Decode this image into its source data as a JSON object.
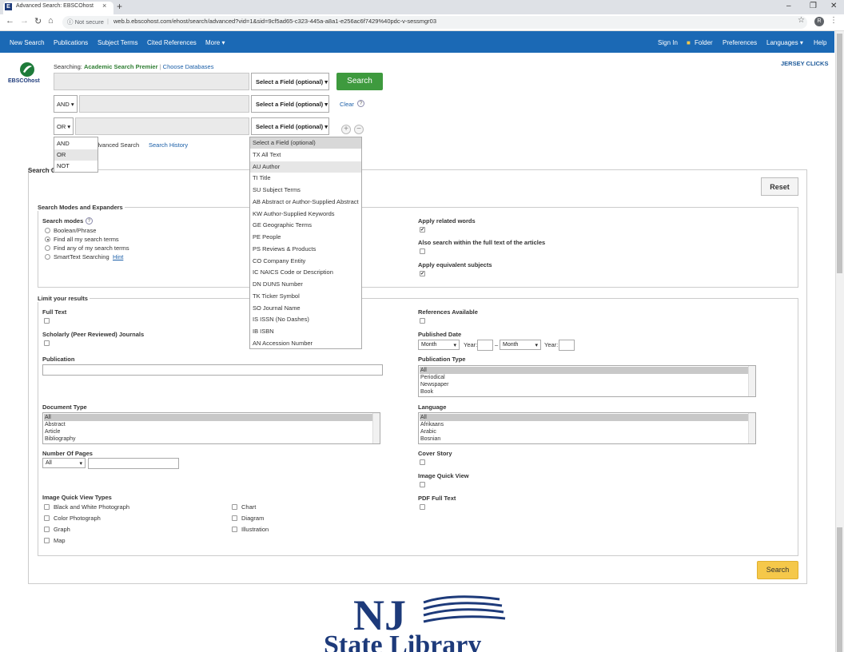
{
  "browser": {
    "tab_title": "Advanced Search: EBSCOhost",
    "tab_favicon": "E",
    "security": "Not secure",
    "url": "web.b.ebscohost.com/ehost/search/advanced?vid=1&sid=9cf5ad65-c323-445a-a8a1-e256ac6f7429%40pdc-v-sessmgr03",
    "profile_initial": "R"
  },
  "toolbar": {
    "left": [
      "New Search",
      "Publications",
      "Subject Terms",
      "Cited References",
      "More ▾"
    ],
    "right": [
      "Sign In",
      "Folder",
      "Preferences",
      "Languages ▾",
      "Help"
    ]
  },
  "logo": {
    "text": "EBSCOhost"
  },
  "institution": "JERSEY CLICKS",
  "searching": {
    "prefix": "Searching:",
    "database": "Academic Search Premier",
    "separator": "|",
    "choose": "Choose Databases"
  },
  "search_rows": [
    {
      "op": "",
      "field": "Select a Field (optional) ▾"
    },
    {
      "op": "AND ▾",
      "field": "Select a Field (optional) ▾"
    },
    {
      "op": "OR ▾",
      "field": "Select a Field (optional) ▾"
    }
  ],
  "search_button": "Search",
  "clear_link": "Clear",
  "help_icon": "?",
  "plus_icon": "+",
  "minus_icon": "−",
  "links": {
    "advanced": "dvanced Search",
    "history": "Search History"
  },
  "op_dropdown": {
    "items": [
      "AND",
      "OR",
      "NOT"
    ],
    "highlighted": 1
  },
  "field_dropdown": {
    "items": [
      "Select a Field (optional)",
      "TX All Text",
      "AU Author",
      "TI Title",
      "SU Subject Terms",
      "AB Abstract or Author-Supplied Abstract",
      "KW Author-Supplied Keywords",
      "GE Geographic Terms",
      "PE People",
      "PS Reviews & Products",
      "CO Company Entity",
      "IC NAICS Code or Description",
      "DN DUNS Number",
      "TK Ticker Symbol",
      "SO Journal Name",
      "IS ISSN (No Dashes)",
      "IB ISBN",
      "AN Accession Number"
    ],
    "highlighted": 2
  },
  "options": {
    "title": "Search O",
    "reset": "Reset",
    "modes_legend": "Search Modes and Expanders",
    "modes_label": "Search modes",
    "modes": [
      "Boolean/Phrase",
      "Find all my search terms",
      "Find any of my search terms",
      "SmartText Searching"
    ],
    "modes_selected": 1,
    "hint": "Hint",
    "expanders": [
      {
        "label": "Apply related words",
        "checked": true
      },
      {
        "label": "Also search within the full text of the articles",
        "checked": false
      },
      {
        "label": "Apply equivalent subjects",
        "checked": true
      }
    ],
    "check_mark": "✔",
    "limit_legend": "Limit your results",
    "full_text": "Full Text",
    "scholarly": "Scholarly (Peer Reviewed) Journals",
    "publication": "Publication",
    "references": "References Available",
    "published_date": "Published Date",
    "month": "Month",
    "year": "Year:",
    "dash": "–",
    "pub_type_label": "Publication Type",
    "pub_types": [
      "All",
      "Periodical",
      "Newspaper",
      "Book"
    ],
    "doc_type_label": "Document Type",
    "doc_types": [
      "All",
      "Abstract",
      "Article",
      "Bibliography"
    ],
    "language_label": "Language",
    "languages": [
      "All",
      "Afrikaans",
      "Arabic",
      "Bosnian"
    ],
    "pages_label": "Number Of Pages",
    "pages_value": "All",
    "cover_story": "Cover Story",
    "image_quick_view": "Image Quick View",
    "pdf_full_text": "PDF Full Text",
    "iqv_types_label": "Image Quick View Types",
    "iqv_col1": [
      "Black and White Photograph",
      "Color Photograph",
      "Graph",
      "Map"
    ],
    "iqv_col2": [
      "Chart",
      "Diagram",
      "Illustration"
    ],
    "search_bottom": "Search"
  },
  "footer_logo": {
    "line1": "NJ",
    "line2": "State Library"
  }
}
